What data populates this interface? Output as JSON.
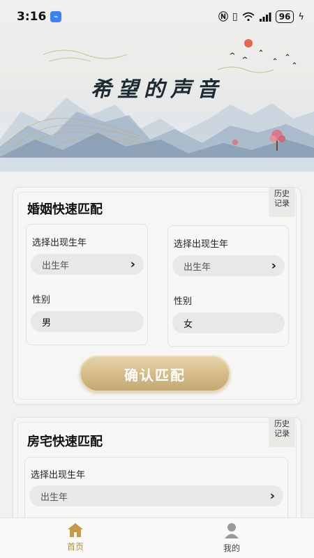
{
  "status_bar": {
    "time": "3:16",
    "battery": "96"
  },
  "banner": {
    "title": "希望的声音"
  },
  "marriage_card": {
    "title": "婚姻快速匹配",
    "history_label_line1": "历史",
    "history_label_line2": "记录",
    "left": {
      "birth_label": "选择出现生年",
      "birth_placeholder": "出生年",
      "gender_label": "性别",
      "gender_value": "男"
    },
    "right": {
      "birth_label": "选择出现生年",
      "birth_placeholder": "出生年",
      "gender_label": "性别",
      "gender_value": "女"
    },
    "confirm_label": "确认匹配"
  },
  "house_card": {
    "title": "房宅快速匹配",
    "history_label_line1": "历史",
    "history_label_line2": "记录",
    "birth_label": "选择出现生年",
    "birth_placeholder": "出生年"
  },
  "bottom_nav": {
    "home_label": "首页",
    "mine_label": "我的"
  },
  "colors": {
    "accent_gold": "#b68c3a",
    "button_gold": "#d3bb86",
    "sun_red": "#e5674a"
  },
  "icons": [
    "usb-icon",
    "nfc-icon",
    "vibrate-icon",
    "wifi-icon",
    "signal-icon",
    "charging-icon",
    "chevron-right-icon",
    "home-icon",
    "user-icon"
  ]
}
